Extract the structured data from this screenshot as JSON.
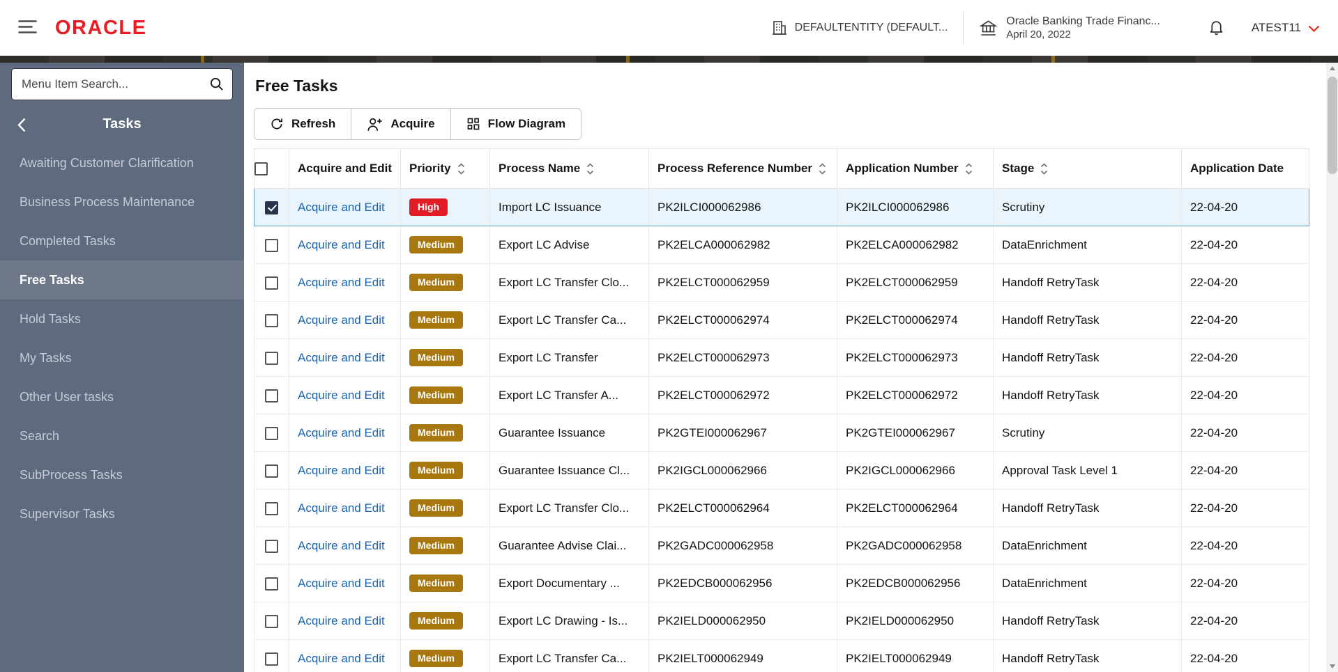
{
  "header": {
    "logo_text": "ORACLE",
    "entity_label": "DEFAULTENTITY (DEFAULT...",
    "app_name": "Oracle Banking Trade Financ...",
    "app_date": "April 20, 2022",
    "user_name": "ATEST11"
  },
  "sidebar": {
    "search_placeholder": "Menu Item Search...",
    "section_title": "Tasks",
    "items": [
      {
        "label": "Awaiting Customer Clarification",
        "active": false
      },
      {
        "label": "Business Process Maintenance",
        "active": false
      },
      {
        "label": "Completed Tasks",
        "active": false
      },
      {
        "label": "Free Tasks",
        "active": true
      },
      {
        "label": "Hold Tasks",
        "active": false
      },
      {
        "label": "My Tasks",
        "active": false
      },
      {
        "label": "Other User tasks",
        "active": false
      },
      {
        "label": "Search",
        "active": false
      },
      {
        "label": "SubProcess Tasks",
        "active": false
      },
      {
        "label": "Supervisor Tasks",
        "active": false
      }
    ]
  },
  "main": {
    "title": "Free Tasks",
    "toolbar": {
      "refresh_label": "Refresh",
      "acquire_label": "Acquire",
      "flow_diagram_label": "Flow Diagram"
    },
    "table": {
      "columns": [
        {
          "label": "Acquire and Edit",
          "sortable": false
        },
        {
          "label": "Priority",
          "sortable": true
        },
        {
          "label": "Process Name",
          "sortable": true
        },
        {
          "label": "Process Reference Number",
          "sortable": true
        },
        {
          "label": "Application Number",
          "sortable": true
        },
        {
          "label": "Stage",
          "sortable": true
        },
        {
          "label": "Application Date",
          "sortable": false
        }
      ],
      "rows": [
        {
          "checked": true,
          "selected": true,
          "action": "Acquire and Edit",
          "priority": "High",
          "process_name": "Import LC Issuance",
          "process_reference_number": "PK2ILCI000062986",
          "application_number": "PK2ILCI000062986",
          "stage": "Scrutiny",
          "application_date": "22-04-20"
        },
        {
          "checked": false,
          "selected": false,
          "action": "Acquire and Edit",
          "priority": "Medium",
          "process_name": "Export LC Advise",
          "process_reference_number": "PK2ELCA000062982",
          "application_number": "PK2ELCA000062982",
          "stage": "DataEnrichment",
          "application_date": "22-04-20"
        },
        {
          "checked": false,
          "selected": false,
          "action": "Acquire and Edit",
          "priority": "Medium",
          "process_name": "Export LC Transfer Clo...",
          "process_reference_number": "PK2ELCT000062959",
          "application_number": "PK2ELCT000062959",
          "stage": "Handoff RetryTask",
          "application_date": "22-04-20"
        },
        {
          "checked": false,
          "selected": false,
          "action": "Acquire and Edit",
          "priority": "Medium",
          "process_name": "Export LC Transfer Ca...",
          "process_reference_number": "PK2ELCT000062974",
          "application_number": "PK2ELCT000062974",
          "stage": "Handoff RetryTask",
          "application_date": "22-04-20"
        },
        {
          "checked": false,
          "selected": false,
          "action": "Acquire and Edit",
          "priority": "Medium",
          "process_name": "Export LC Transfer",
          "process_reference_number": "PK2ELCT000062973",
          "application_number": "PK2ELCT000062973",
          "stage": "Handoff RetryTask",
          "application_date": "22-04-20"
        },
        {
          "checked": false,
          "selected": false,
          "action": "Acquire and Edit",
          "priority": "Medium",
          "process_name": "Export LC Transfer A...",
          "process_reference_number": "PK2ELCT000062972",
          "application_number": "PK2ELCT000062972",
          "stage": "Handoff RetryTask",
          "application_date": "22-04-20"
        },
        {
          "checked": false,
          "selected": false,
          "action": "Acquire and Edit",
          "priority": "Medium",
          "process_name": "Guarantee Issuance",
          "process_reference_number": "PK2GTEI000062967",
          "application_number": "PK2GTEI000062967",
          "stage": "Scrutiny",
          "application_date": "22-04-20"
        },
        {
          "checked": false,
          "selected": false,
          "action": "Acquire and Edit",
          "priority": "Medium",
          "process_name": "Guarantee Issuance Cl...",
          "process_reference_number": "PK2IGCL000062966",
          "application_number": "PK2IGCL000062966",
          "stage": "Approval Task Level 1",
          "application_date": "22-04-20"
        },
        {
          "checked": false,
          "selected": false,
          "action": "Acquire and Edit",
          "priority": "Medium",
          "process_name": "Export LC Transfer Clo...",
          "process_reference_number": "PK2ELCT000062964",
          "application_number": "PK2ELCT000062964",
          "stage": "Handoff RetryTask",
          "application_date": "22-04-20"
        },
        {
          "checked": false,
          "selected": false,
          "action": "Acquire and Edit",
          "priority": "Medium",
          "process_name": "Guarantee Advise Clai...",
          "process_reference_number": "PK2GADC000062958",
          "application_number": "PK2GADC000062958",
          "stage": "DataEnrichment",
          "application_date": "22-04-20"
        },
        {
          "checked": false,
          "selected": false,
          "action": "Acquire and Edit",
          "priority": "Medium",
          "process_name": "Export Documentary ...",
          "process_reference_number": "PK2EDCB000062956",
          "application_number": "PK2EDCB000062956",
          "stage": "DataEnrichment",
          "application_date": "22-04-20"
        },
        {
          "checked": false,
          "selected": false,
          "action": "Acquire and Edit",
          "priority": "Medium",
          "process_name": "Export LC Drawing - Is...",
          "process_reference_number": "PK2IELD000062950",
          "application_number": "PK2IELD000062950",
          "stage": "Handoff RetryTask",
          "application_date": "22-04-20"
        },
        {
          "checked": false,
          "selected": false,
          "action": "Acquire and Edit",
          "priority": "Medium",
          "process_name": "Export LC Transfer Ca...",
          "process_reference_number": "PK2IELT000062949",
          "application_number": "PK2IELT000062949",
          "stage": "Handoff RetryTask",
          "application_date": "22-04-20"
        }
      ]
    }
  },
  "colors": {
    "oracle_red": "#ea1b22",
    "accent_red": "#e0301e",
    "sidebar_bg": "#5e6a7d",
    "sidebar_active_bg": "#6e7889",
    "link_blue": "#1763ae",
    "priority_high": "#e11c25",
    "priority_medium": "#a8770e",
    "checkbox_checked": "#27344c",
    "selected_row_bg": "#e9f4fc",
    "selected_row_border": "#5b9bd5"
  }
}
